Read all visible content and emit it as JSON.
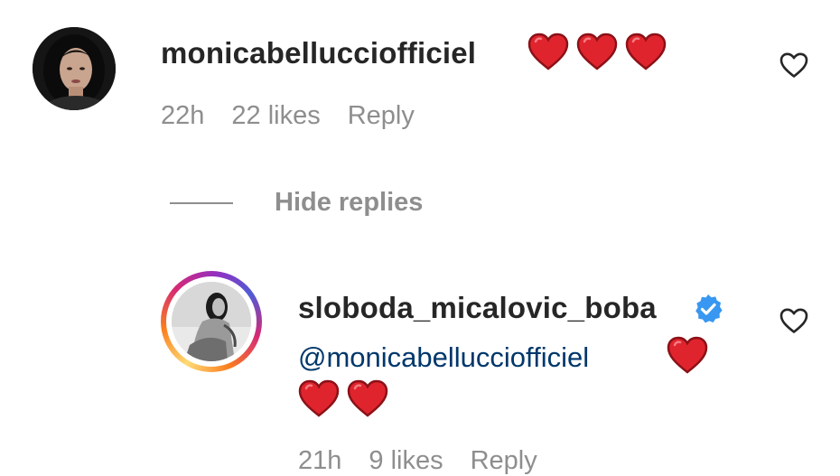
{
  "comment": {
    "username": "monicabellucciofficiel",
    "time": "22h",
    "likes": "22 likes",
    "reply_label": "Reply",
    "avatar_icon": "profile-avatar"
  },
  "hide_replies_label": "Hide replies",
  "reply": {
    "username": "sloboda_micalovic_boba",
    "mention": "@monicabellucciofficiel",
    "time": "21h",
    "likes": "9 likes",
    "reply_label": "Reply",
    "verified_icon": "verified-badge-icon",
    "avatar_icon": "profile-avatar-story-ring"
  },
  "colors": {
    "heart_emoji": "#e0242e",
    "verified": "#3897f0",
    "mention": "#00376b",
    "meta_text": "#8e8e8e",
    "username": "#262626"
  },
  "icons": {
    "like": "heart-outline-icon",
    "emoji": "red-heart-emoji"
  }
}
